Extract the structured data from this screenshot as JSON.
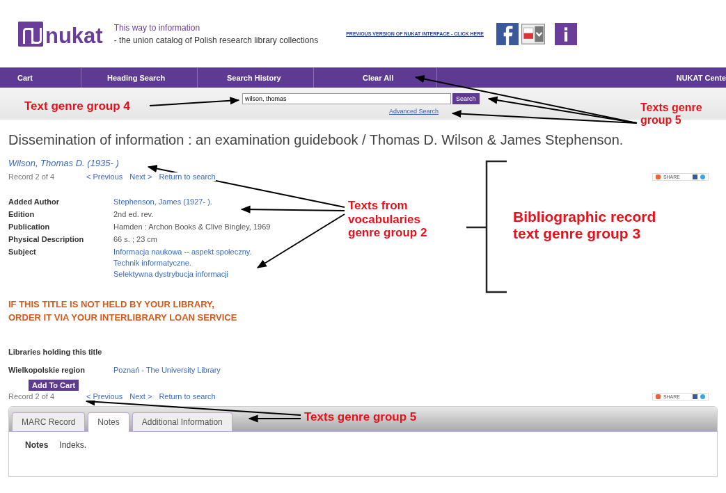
{
  "header": {
    "logo": "nukat",
    "tagline": "This way to information",
    "subtitle": "- the union catalog of Polish research library collections",
    "previous_version_link": "PREVIOUS VERSION OF NUKAT INTERFACE - CLICK HERE"
  },
  "nav": [
    "Cart",
    "Heading Search",
    "Search History",
    "Clear All",
    "NUKAT Cente"
  ],
  "search": {
    "value": "wilson, thomas",
    "button": "Search",
    "advanced_link": "Advanced Search"
  },
  "record": {
    "title": "Dissemination of information : an examination guidebook / Thomas D. Wilson & James Stephenson.",
    "author": "Wilson, Thomas D. (1935- )",
    "record_nav": {
      "count": "Record 2 of 4",
      "previous": "< Previous",
      "next": "Next >",
      "return": "Return to search"
    },
    "share": "SHARE",
    "fields": [
      {
        "label": "Added Author",
        "kind": "link",
        "values": [
          "Stephenson, James (1927- )."
        ]
      },
      {
        "label": "Edition",
        "kind": "text",
        "values": [
          "2nd ed. rev."
        ]
      },
      {
        "label": "Publication",
        "kind": "text",
        "values": [
          "Hamden : Archon Books & Clive Bingley, 1969"
        ]
      },
      {
        "label": "Physical Description",
        "kind": "text",
        "values": [
          "66 s. ; 23 cm"
        ]
      },
      {
        "label": "Subject",
        "kind": "link",
        "values": [
          "Informacja naukowa -- aspekt społeczny.",
          "Technik informatyczne.",
          "Selektywna dystrybucja informacji"
        ]
      }
    ]
  },
  "notice": [
    "IF THIS TITLE IS NOT HELD BY YOUR LIBRARY,",
    "ORDER IT VIA YOUR INTERLIBRARY LOAN SERVICE"
  ],
  "holdings": {
    "heading": "Libraries holding this title",
    "region": "Wielkopolskie region",
    "library": "Poznań - The University Library",
    "add_button": "Add To Cart"
  },
  "record_nav_bottom": {
    "count": "Record 2 of 4",
    "previous": "< Previous",
    "next": "Next >",
    "return": "Return to search"
  },
  "share_bottom": "SHARE",
  "tabs": [
    {
      "label": "MARC Record",
      "selected": false
    },
    {
      "label": "Notes",
      "selected": true
    },
    {
      "label": "Additional Information",
      "selected": false
    }
  ],
  "notes": {
    "label": "Notes",
    "value": "Indeks."
  },
  "annotations": [
    "Text genre group 4",
    "Texts genre group 5",
    "Texts from vocabularies genre group 2",
    "Bibliographic record text genre group 3",
    "Texts genre group 5"
  ]
}
